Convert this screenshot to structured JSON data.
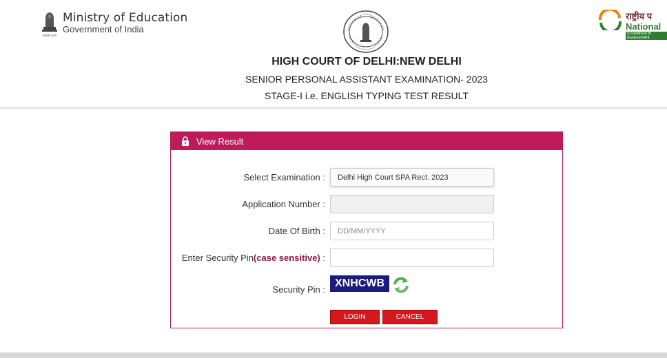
{
  "header": {
    "ministry_title": "Ministry of Education",
    "ministry_subtitle": "Government of India",
    "emblem_motto": "सत्यमेव जयते",
    "nta_hindi": "राष्ट्रीय प",
    "nta_english": "National",
    "nta_tagline": "Excellence in Assessment",
    "title_line1": "HIGH COURT OF DELHI:NEW DELHI",
    "title_line2": "SENIOR PERSONAL ASSISTANT EXAMINATION- 2023",
    "title_line3": "STAGE-I i.e. ENGLISH TYPING TEST RESULT"
  },
  "panel": {
    "heading": "View Result",
    "accent_color": "#bf1b5a",
    "fields": {
      "exam_label": "Select Examination :",
      "exam_value": "Delhi High Court SPA Rect. 2023",
      "app_label": "Application Number :",
      "app_value": "",
      "dob_label": "Date Of Birth :",
      "dob_placeholder": "DD/MM/YYYY",
      "pin_label_prefix": "Enter Security Pin",
      "pin_label_emph": "(case sensitive)",
      "pin_label_suffix": " :",
      "pin_value": "",
      "captcha_label": "Security Pin :",
      "captcha_text": "XNHCWB"
    },
    "buttons": {
      "login": "LOGIN",
      "cancel": "CANCEL",
      "button_color": "#d5171f"
    }
  },
  "icons": [
    "ashoka-emblem-icon",
    "delhi-high-court-seal-icon",
    "nta-logo-icon",
    "lock-icon",
    "refresh-icon"
  ]
}
